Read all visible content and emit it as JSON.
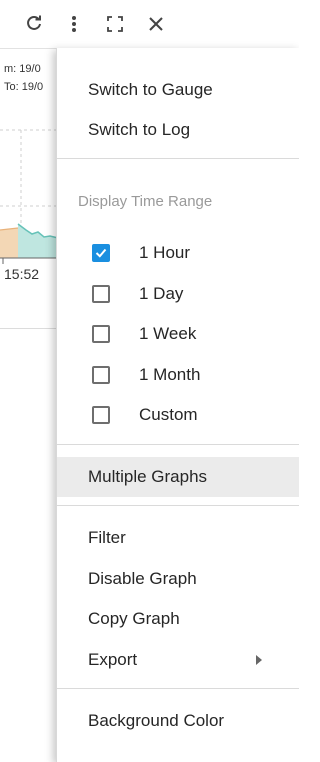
{
  "toolbar": {
    "icons": [
      "refresh-icon",
      "more-vertical-icon",
      "fullscreen-icon",
      "close-icon"
    ]
  },
  "chart": {
    "range_from": "m: 19/0",
    "range_to": "To: 19/0",
    "x_tick": "15:52",
    "fill_color": "#f3d7b5",
    "line_color": "#66c2b8"
  },
  "menu": {
    "items_top": [
      {
        "label": "Switch to Gauge"
      },
      {
        "label": "Switch to Log"
      }
    ],
    "time_range": {
      "header": "Display Time Range",
      "options": [
        {
          "label": "1 Hour",
          "checked": true
        },
        {
          "label": "1 Day",
          "checked": false
        },
        {
          "label": "1 Week",
          "checked": false
        },
        {
          "label": "1 Month",
          "checked": false
        },
        {
          "label": "Custom",
          "checked": false
        }
      ]
    },
    "multiple_graphs": "Multiple Graphs",
    "items_mid": [
      {
        "label": "Filter"
      },
      {
        "label": "Disable Graph"
      },
      {
        "label": "Copy Graph"
      },
      {
        "label": "Export",
        "has_submenu": true
      }
    ],
    "background_color": "Background Color",
    "accent_color": "#1a8fe0"
  }
}
